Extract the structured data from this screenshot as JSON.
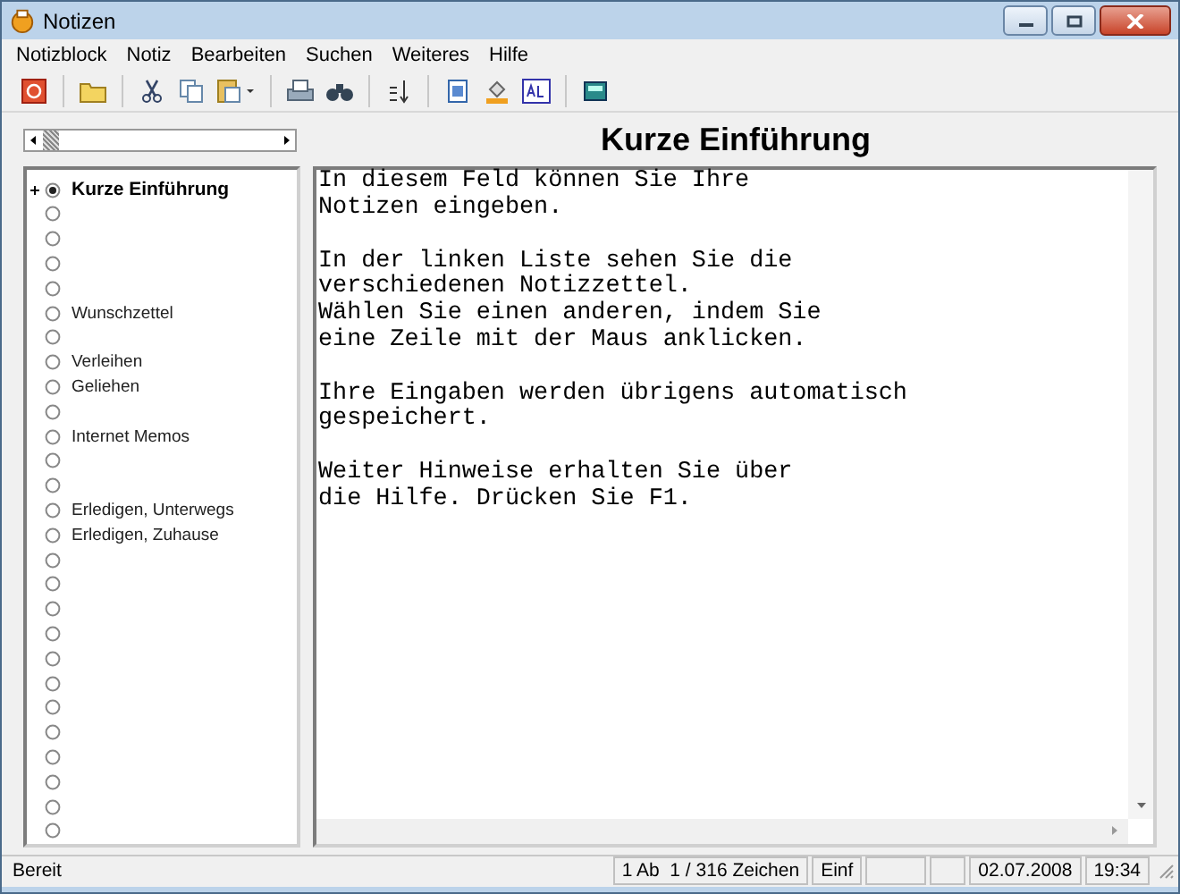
{
  "window": {
    "title": "Notizen"
  },
  "menu": [
    "Notizblock",
    "Notiz",
    "Bearbeiten",
    "Suchen",
    "Weiteres",
    "Hilfe"
  ],
  "note_title": "Kurze Einführung",
  "notes": [
    {
      "label": "Kurze Einführung",
      "selected": true,
      "expandable": true
    },
    {
      "selected": false,
      "expandable": false
    },
    {
      "selected": false,
      "expandable": false
    },
    {
      "selected": false,
      "expandable": false
    },
    {
      "selected": false,
      "expandable": false
    },
    {
      "label": "Wunschzettel",
      "selected": false,
      "expandable": false
    },
    {
      "selected": false,
      "expandable": false
    },
    {
      "label": "Verleihen",
      "selected": false,
      "expandable": false
    },
    {
      "label": "Geliehen",
      "selected": false,
      "expandable": false
    },
    {
      "selected": false,
      "expandable": false
    },
    {
      "label": "Internet Memos",
      "selected": false,
      "expandable": false
    },
    {
      "selected": false,
      "expandable": false
    },
    {
      "selected": false,
      "expandable": false
    },
    {
      "label": "Erledigen, Unterwegs",
      "selected": false,
      "expandable": false
    },
    {
      "label": "Erledigen, Zuhause",
      "selected": false,
      "expandable": false
    },
    {
      "selected": false,
      "expandable": false
    },
    {
      "selected": false,
      "expandable": false
    },
    {
      "selected": false,
      "expandable": false
    },
    {
      "selected": false,
      "expandable": false
    },
    {
      "selected": false,
      "expandable": false
    },
    {
      "selected": false,
      "expandable": false
    },
    {
      "selected": false,
      "expandable": false
    },
    {
      "selected": false,
      "expandable": false
    },
    {
      "selected": false,
      "expandable": false
    },
    {
      "selected": false,
      "expandable": false
    },
    {
      "selected": false,
      "expandable": false
    },
    {
      "selected": false,
      "expandable": false
    }
  ],
  "note_text": [
    [
      "In diesem Feld können Sie Ihre",
      "Notizen eingeben."
    ],
    [
      "In der linken Liste sehen Sie die",
      "verschiedenen Notizzettel.",
      "Wählen Sie einen anderen, indem Sie",
      "eine Zeile mit der Maus anklicken."
    ],
    [
      "Ihre Eingaben werden übrigens automatisch",
      "gespeichert."
    ],
    [
      "Weiter Hinweise erhalten Sie über",
      "die Hilfe. Drücken Sie F1."
    ]
  ],
  "status_bar": {
    "status": "Bereit",
    "position": "1 Ab  1 / 316 Zeichen",
    "mode": "Einf",
    "date": "02.07.2008",
    "time": "19:34"
  }
}
